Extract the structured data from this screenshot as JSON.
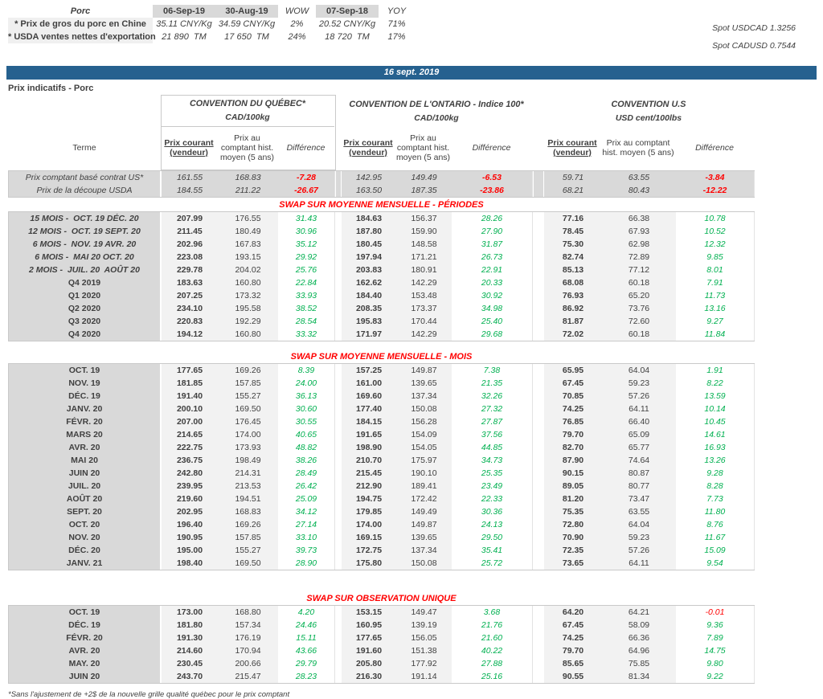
{
  "top": {
    "title": "Porc",
    "headers": [
      "06-Sep-19",
      "30-Aug-19",
      "WOW",
      "07-Sep-18",
      "YOY"
    ],
    "rows": [
      {
        "label": "* Prix de gros du porc en Chine",
        "values": [
          "35.11 CNY/Kg",
          "34.59 CNY/Kg",
          "2%",
          "20.52 CNY/Kg",
          "71%"
        ]
      },
      {
        "label": "* USDA ventes nettes d'exportation",
        "values": [
          "21 890  TM",
          "17 650  TM",
          "24%",
          "18 720  TM",
          "17%"
        ]
      }
    ],
    "spot": [
      "Spot USDCAD 1.3256",
      "Spot CADUSD 0.7544"
    ]
  },
  "banner": "16 sept. 2019",
  "page_title": "Prix indicatifs - Porc",
  "groups": [
    {
      "title": "CONVENTION DU QUÉBEC*",
      "unit": "CAD/100kg"
    },
    {
      "title": "CONVENTION DE L'ONTARIO - Indice 100*",
      "unit": "CAD/100kg"
    },
    {
      "title": "CONVENTION U.S",
      "unit": "USD cent/100lbs"
    }
  ],
  "columns": {
    "terme": "Terme",
    "current_l1": "Prix courant",
    "current_l2": "(vendeur)",
    "hist": "Prix au comptant hist. moyen (5 ans)",
    "diff": "Différence"
  },
  "spot_rows": [
    {
      "terme": "Prix comptant basé contrat US*",
      "values": [
        "161.55",
        "168.83",
        "-7.28",
        "142.95",
        "149.49",
        "-6.53",
        "59.71",
        "63.55",
        "-3.84"
      ]
    },
    {
      "terme": "Prix de la découpe USDA",
      "values": [
        "184.55",
        "211.22",
        "-26.67",
        "163.50",
        "187.35",
        "-23.86",
        "68.21",
        "80.43",
        "-12.22"
      ]
    }
  ],
  "sections": [
    {
      "header": "SWAP SUR MOYENNE MENSUELLE - PÉRIODES",
      "rows": [
        {
          "terme": "15 MOIS -  OCT. 19 DÉC. 20",
          "values": [
            "207.99",
            "176.55",
            "31.43",
            "184.63",
            "156.37",
            "28.26",
            "77.16",
            "66.38",
            "10.78"
          ]
        },
        {
          "terme": "12 MOIS -  OCT. 19 SEPT. 20",
          "values": [
            "211.45",
            "180.49",
            "30.96",
            "187.80",
            "159.90",
            "27.90",
            "78.45",
            "67.93",
            "10.52"
          ]
        },
        {
          "terme": "6 MOIS -  NOV. 19 AVR. 20",
          "values": [
            "202.96",
            "167.83",
            "35.12",
            "180.45",
            "148.58",
            "31.87",
            "75.30",
            "62.98",
            "12.32"
          ]
        },
        {
          "terme": "6 MOIS -  MAI 20 OCT. 20",
          "values": [
            "223.08",
            "193.15",
            "29.92",
            "197.94",
            "171.21",
            "26.73",
            "82.74",
            "72.89",
            "9.85"
          ]
        },
        {
          "terme": "2 MOIS -  JUIL. 20  AOÛT 20",
          "values": [
            "229.78",
            "204.02",
            "25.76",
            "203.83",
            "180.91",
            "22.91",
            "85.13",
            "77.12",
            "8.01"
          ]
        },
        {
          "terme": "Q4 2019",
          "values": [
            "183.63",
            "160.80",
            "22.84",
            "162.62",
            "142.29",
            "20.33",
            "68.08",
            "60.18",
            "7.91"
          ]
        },
        {
          "terme": "Q1 2020",
          "values": [
            "207.25",
            "173.32",
            "33.93",
            "184.40",
            "153.48",
            "30.92",
            "76.93",
            "65.20",
            "11.73"
          ]
        },
        {
          "terme": "Q2 2020",
          "values": [
            "234.10",
            "195.58",
            "38.52",
            "208.35",
            "173.37",
            "34.98",
            "86.92",
            "73.76",
            "13.16"
          ]
        },
        {
          "terme": "Q3 2020",
          "values": [
            "220.83",
            "192.29",
            "28.54",
            "195.83",
            "170.44",
            "25.40",
            "81.87",
            "72.60",
            "9.27"
          ]
        },
        {
          "terme": "Q4 2020",
          "values": [
            "194.12",
            "160.80",
            "33.32",
            "171.97",
            "142.29",
            "29.68",
            "72.02",
            "60.18",
            "11.84"
          ]
        }
      ]
    },
    {
      "header": "SWAP SUR MOYENNE MENSUELLE - MOIS",
      "rows": [
        {
          "terme": "OCT. 19",
          "values": [
            "177.65",
            "169.26",
            "8.39",
            "157.25",
            "149.87",
            "7.38",
            "65.95",
            "64.04",
            "1.91"
          ]
        },
        {
          "terme": "NOV. 19",
          "values": [
            "181.85",
            "157.85",
            "24.00",
            "161.00",
            "139.65",
            "21.35",
            "67.45",
            "59.23",
            "8.22"
          ]
        },
        {
          "terme": "DÉC. 19",
          "values": [
            "191.40",
            "155.27",
            "36.13",
            "169.60",
            "137.34",
            "32.26",
            "70.85",
            "57.26",
            "13.59"
          ]
        },
        {
          "terme": "JANV. 20",
          "values": [
            "200.10",
            "169.50",
            "30.60",
            "177.40",
            "150.08",
            "27.32",
            "74.25",
            "64.11",
            "10.14"
          ]
        },
        {
          "terme": "FÉVR. 20",
          "values": [
            "207.00",
            "176.45",
            "30.55",
            "184.15",
            "156.28",
            "27.87",
            "76.85",
            "66.40",
            "10.45"
          ]
        },
        {
          "terme": "MARS 20",
          "values": [
            "214.65",
            "174.00",
            "40.65",
            "191.65",
            "154.09",
            "37.56",
            "79.70",
            "65.09",
            "14.61"
          ]
        },
        {
          "terme": "AVR. 20",
          "values": [
            "222.75",
            "173.93",
            "48.82",
            "198.90",
            "154.05",
            "44.85",
            "82.70",
            "65.77",
            "16.93"
          ]
        },
        {
          "terme": "MAI 20",
          "values": [
            "236.75",
            "198.49",
            "38.26",
            "210.70",
            "175.97",
            "34.73",
            "87.90",
            "74.64",
            "13.26"
          ]
        },
        {
          "terme": "JUIN 20",
          "values": [
            "242.80",
            "214.31",
            "28.49",
            "215.45",
            "190.10",
            "25.35",
            "90.15",
            "80.87",
            "9.28"
          ]
        },
        {
          "terme": "JUIL. 20",
          "values": [
            "239.95",
            "213.53",
            "26.42",
            "212.90",
            "189.41",
            "23.49",
            "89.05",
            "80.77",
            "8.28"
          ]
        },
        {
          "terme": "AOÛT 20",
          "values": [
            "219.60",
            "194.51",
            "25.09",
            "194.75",
            "172.42",
            "22.33",
            "81.20",
            "73.47",
            "7.73"
          ]
        },
        {
          "terme": "SEPT. 20",
          "values": [
            "202.95",
            "168.83",
            "34.12",
            "179.85",
            "149.49",
            "30.36",
            "75.35",
            "63.55",
            "11.80"
          ]
        },
        {
          "terme": "OCT. 20",
          "values": [
            "196.40",
            "169.26",
            "27.14",
            "174.00",
            "149.87",
            "24.13",
            "72.80",
            "64.04",
            "8.76"
          ]
        },
        {
          "terme": "NOV. 20",
          "values": [
            "190.95",
            "157.85",
            "33.10",
            "169.15",
            "139.65",
            "29.50",
            "70.90",
            "59.23",
            "11.67"
          ]
        },
        {
          "terme": "DÉC. 20",
          "values": [
            "195.00",
            "155.27",
            "39.73",
            "172.75",
            "137.34",
            "35.41",
            "72.35",
            "57.26",
            "15.09"
          ]
        },
        {
          "terme": "JANV. 21",
          "values": [
            "198.40",
            "169.50",
            "28.90",
            "175.80",
            "150.08",
            "25.72",
            "73.65",
            "64.11",
            "9.54"
          ]
        }
      ]
    },
    {
      "header": "SWAP SUR OBSERVATION UNIQUE",
      "rows": [
        {
          "terme": "OCT. 19",
          "values": [
            "173.00",
            "168.80",
            "4.20",
            "153.15",
            "149.47",
            "3.68",
            "64.20",
            "64.21",
            "-0.01"
          ]
        },
        {
          "terme": "DÉC. 19",
          "values": [
            "181.80",
            "157.34",
            "24.46",
            "160.95",
            "139.19",
            "21.76",
            "67.45",
            "58.09",
            "9.36"
          ]
        },
        {
          "terme": "FÉVR. 20",
          "values": [
            "191.30",
            "176.19",
            "15.11",
            "177.65",
            "156.05",
            "21.60",
            "74.25",
            "66.36",
            "7.89"
          ]
        },
        {
          "terme": "AVR. 20",
          "values": [
            "214.60",
            "170.94",
            "43.66",
            "191.60",
            "151.38",
            "40.22",
            "79.70",
            "64.96",
            "14.75"
          ]
        },
        {
          "terme": "MAY. 20",
          "values": [
            "230.45",
            "200.66",
            "29.79",
            "205.80",
            "177.92",
            "27.88",
            "85.65",
            "75.85",
            "9.80"
          ]
        },
        {
          "terme": "JUIN 20",
          "values": [
            "243.70",
            "215.47",
            "28.23",
            "216.30",
            "191.14",
            "25.16",
            "90.55",
            "81.34",
            "9.22"
          ]
        }
      ]
    }
  ],
  "footnote": "*Sans l'ajustement de +2$ de la nouvelle grille qualité québec pour le prix comptant",
  "colors": {
    "positive": "#00B050",
    "negative": "#FF0000",
    "banner": "#26618F"
  }
}
